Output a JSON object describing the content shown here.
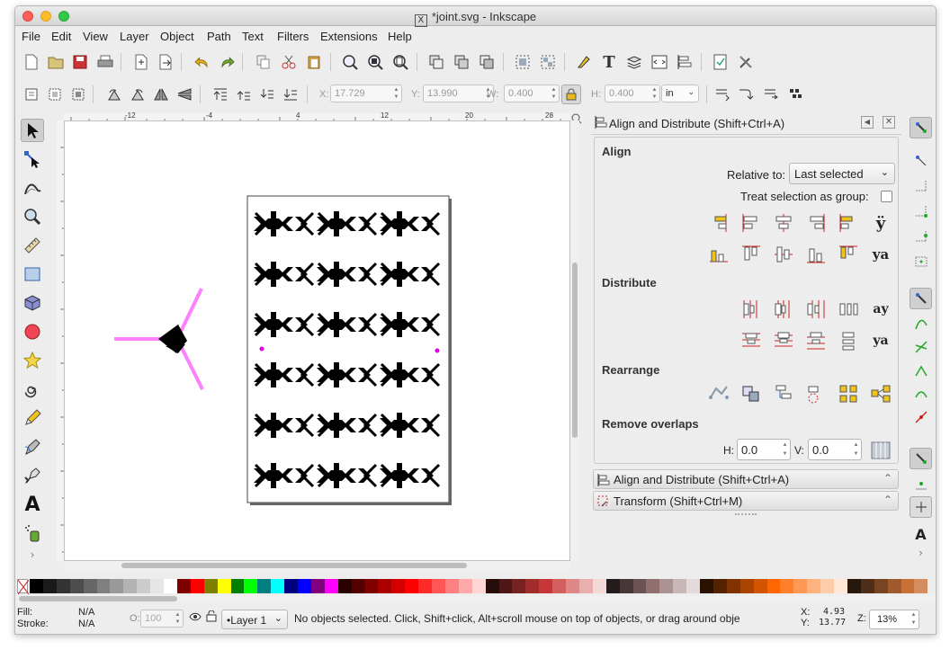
{
  "window": {
    "title": "*joint.svg - Inkscape",
    "x_glyph": "X"
  },
  "menu": [
    "File",
    "Edit",
    "View",
    "Layer",
    "Object",
    "Path",
    "Text",
    "Filters",
    "Extensions",
    "Help"
  ],
  "toolbar": {
    "x_label": "X:",
    "x_value": "17.729",
    "y_label": "Y:",
    "y_value": "13.990",
    "w_label": "W:",
    "w_value": "0.400",
    "h_label": "H:",
    "h_value": "0.400",
    "unit": "in"
  },
  "ruler": {
    "ticks": [
      "-12",
      "-4",
      "4",
      "12",
      "20",
      "28"
    ]
  },
  "align_panel": {
    "title": "Align and Distribute (Shift+Ctrl+A)",
    "align_heading": "Align",
    "relative_label": "Relative to:",
    "relative_value": "Last selected",
    "treat_group_label": "Treat selection as group:",
    "distribute_heading": "Distribute",
    "rearrange_heading": "Rearrange",
    "remove_overlaps_heading": "Remove overlaps",
    "h_label": "H:",
    "h_value": "0.0",
    "v_label": "V:",
    "v_value": "0.0"
  },
  "dock_tabs": {
    "align_tab": "Align and Distribute (Shift+Ctrl+A)",
    "transform_tab": "Transform (Shift+Ctrl+M)"
  },
  "palette_colors": [
    "#000000",
    "#1a1a1a",
    "#333333",
    "#4d4d4d",
    "#666666",
    "#808080",
    "#999999",
    "#b3b3b3",
    "#cccccc",
    "#e6e6e6",
    "#ffffff",
    "#800000",
    "#ff0000",
    "#808000",
    "#ffff00",
    "#008000",
    "#00ff00",
    "#008080",
    "#00ffff",
    "#000080",
    "#0000ff",
    "#800080",
    "#ff00ff",
    "#2b0000",
    "#550000",
    "#800000",
    "#aa0000",
    "#d40000",
    "#ff0000",
    "#ff2a2a",
    "#ff5555",
    "#ff8080",
    "#ffaaaa",
    "#ffd5d5",
    "#280b0b",
    "#501616",
    "#782121",
    "#a02c2c",
    "#c83737",
    "#d35f5f",
    "#de8787",
    "#e9afaf",
    "#f4d7d7",
    "#241c1c",
    "#483737",
    "#6c5353",
    "#916f6f",
    "#ac9393",
    "#c8b7b7",
    "#e3dbdb",
    "#2b1100",
    "#552200",
    "#803300",
    "#aa4400",
    "#d45500",
    "#ff6600",
    "#ff7f2a",
    "#ff9955",
    "#ffb380",
    "#ffccaa",
    "#ffe6d5",
    "#28170b",
    "#502d16",
    "#784421",
    "#a05a2c",
    "#c87137",
    "#d38d5f"
  ],
  "status": {
    "fill_label": "Fill:",
    "fill_value": "N/A",
    "stroke_label": "Stroke:",
    "stroke_value": "N/A",
    "opacity_label": "O:",
    "opacity_value": "100",
    "layer": "•Layer 1",
    "message": "No objects selected. Click, Shift+click, Alt+scroll mouse on top of objects, or drag around obje",
    "cx_label": "X:",
    "cx_value": "4.93",
    "cy_label": "Y:",
    "cy_value": "13.77",
    "zoom_label": "Z:",
    "zoom_value": "13%"
  },
  "colors": {
    "accent_pink": "#ff80ff",
    "marker_magenta": "#e000e0",
    "icon_blue": "#3366aa",
    "icon_red": "#cc2222",
    "icon_yellow": "#f0c419"
  }
}
